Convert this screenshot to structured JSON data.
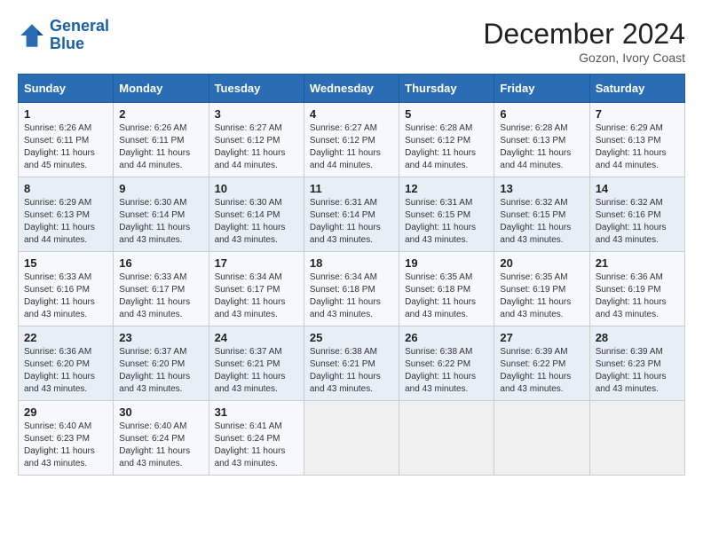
{
  "header": {
    "logo_line1": "General",
    "logo_line2": "Blue",
    "month_title": "December 2024",
    "subtitle": "Gozon, Ivory Coast"
  },
  "days_of_week": [
    "Sunday",
    "Monday",
    "Tuesday",
    "Wednesday",
    "Thursday",
    "Friday",
    "Saturday"
  ],
  "weeks": [
    [
      {
        "day": "1",
        "sunrise": "6:26 AM",
        "sunset": "6:11 PM",
        "daylight": "11 hours and 45 minutes."
      },
      {
        "day": "2",
        "sunrise": "6:26 AM",
        "sunset": "6:11 PM",
        "daylight": "11 hours and 44 minutes."
      },
      {
        "day": "3",
        "sunrise": "6:27 AM",
        "sunset": "6:12 PM",
        "daylight": "11 hours and 44 minutes."
      },
      {
        "day": "4",
        "sunrise": "6:27 AM",
        "sunset": "6:12 PM",
        "daylight": "11 hours and 44 minutes."
      },
      {
        "day": "5",
        "sunrise": "6:28 AM",
        "sunset": "6:12 PM",
        "daylight": "11 hours and 44 minutes."
      },
      {
        "day": "6",
        "sunrise": "6:28 AM",
        "sunset": "6:13 PM",
        "daylight": "11 hours and 44 minutes."
      },
      {
        "day": "7",
        "sunrise": "6:29 AM",
        "sunset": "6:13 PM",
        "daylight": "11 hours and 44 minutes."
      }
    ],
    [
      {
        "day": "8",
        "sunrise": "6:29 AM",
        "sunset": "6:13 PM",
        "daylight": "11 hours and 44 minutes."
      },
      {
        "day": "9",
        "sunrise": "6:30 AM",
        "sunset": "6:14 PM",
        "daylight": "11 hours and 43 minutes."
      },
      {
        "day": "10",
        "sunrise": "6:30 AM",
        "sunset": "6:14 PM",
        "daylight": "11 hours and 43 minutes."
      },
      {
        "day": "11",
        "sunrise": "6:31 AM",
        "sunset": "6:14 PM",
        "daylight": "11 hours and 43 minutes."
      },
      {
        "day": "12",
        "sunrise": "6:31 AM",
        "sunset": "6:15 PM",
        "daylight": "11 hours and 43 minutes."
      },
      {
        "day": "13",
        "sunrise": "6:32 AM",
        "sunset": "6:15 PM",
        "daylight": "11 hours and 43 minutes."
      },
      {
        "day": "14",
        "sunrise": "6:32 AM",
        "sunset": "6:16 PM",
        "daylight": "11 hours and 43 minutes."
      }
    ],
    [
      {
        "day": "15",
        "sunrise": "6:33 AM",
        "sunset": "6:16 PM",
        "daylight": "11 hours and 43 minutes."
      },
      {
        "day": "16",
        "sunrise": "6:33 AM",
        "sunset": "6:17 PM",
        "daylight": "11 hours and 43 minutes."
      },
      {
        "day": "17",
        "sunrise": "6:34 AM",
        "sunset": "6:17 PM",
        "daylight": "11 hours and 43 minutes."
      },
      {
        "day": "18",
        "sunrise": "6:34 AM",
        "sunset": "6:18 PM",
        "daylight": "11 hours and 43 minutes."
      },
      {
        "day": "19",
        "sunrise": "6:35 AM",
        "sunset": "6:18 PM",
        "daylight": "11 hours and 43 minutes."
      },
      {
        "day": "20",
        "sunrise": "6:35 AM",
        "sunset": "6:19 PM",
        "daylight": "11 hours and 43 minutes."
      },
      {
        "day": "21",
        "sunrise": "6:36 AM",
        "sunset": "6:19 PM",
        "daylight": "11 hours and 43 minutes."
      }
    ],
    [
      {
        "day": "22",
        "sunrise": "6:36 AM",
        "sunset": "6:20 PM",
        "daylight": "11 hours and 43 minutes."
      },
      {
        "day": "23",
        "sunrise": "6:37 AM",
        "sunset": "6:20 PM",
        "daylight": "11 hours and 43 minutes."
      },
      {
        "day": "24",
        "sunrise": "6:37 AM",
        "sunset": "6:21 PM",
        "daylight": "11 hours and 43 minutes."
      },
      {
        "day": "25",
        "sunrise": "6:38 AM",
        "sunset": "6:21 PM",
        "daylight": "11 hours and 43 minutes."
      },
      {
        "day": "26",
        "sunrise": "6:38 AM",
        "sunset": "6:22 PM",
        "daylight": "11 hours and 43 minutes."
      },
      {
        "day": "27",
        "sunrise": "6:39 AM",
        "sunset": "6:22 PM",
        "daylight": "11 hours and 43 minutes."
      },
      {
        "day": "28",
        "sunrise": "6:39 AM",
        "sunset": "6:23 PM",
        "daylight": "11 hours and 43 minutes."
      }
    ],
    [
      {
        "day": "29",
        "sunrise": "6:40 AM",
        "sunset": "6:23 PM",
        "daylight": "11 hours and 43 minutes."
      },
      {
        "day": "30",
        "sunrise": "6:40 AM",
        "sunset": "6:24 PM",
        "daylight": "11 hours and 43 minutes."
      },
      {
        "day": "31",
        "sunrise": "6:41 AM",
        "sunset": "6:24 PM",
        "daylight": "11 hours and 43 minutes."
      },
      null,
      null,
      null,
      null
    ]
  ]
}
